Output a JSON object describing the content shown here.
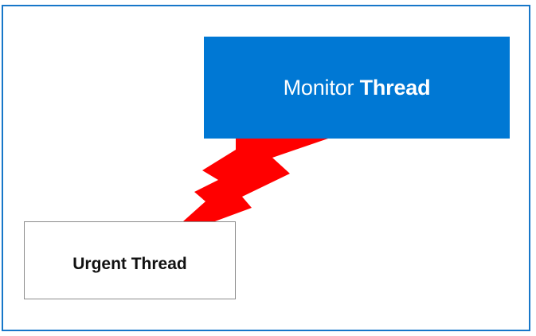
{
  "monitor": {
    "word1": "Monitor",
    "word2": "Thread",
    "color": "#0078d4"
  },
  "urgent": {
    "label": "Urgent Thread"
  },
  "connector": {
    "shape": "lightning-bolt",
    "color": "#ff0000"
  },
  "frame": {
    "border_color": "#1777c9"
  }
}
